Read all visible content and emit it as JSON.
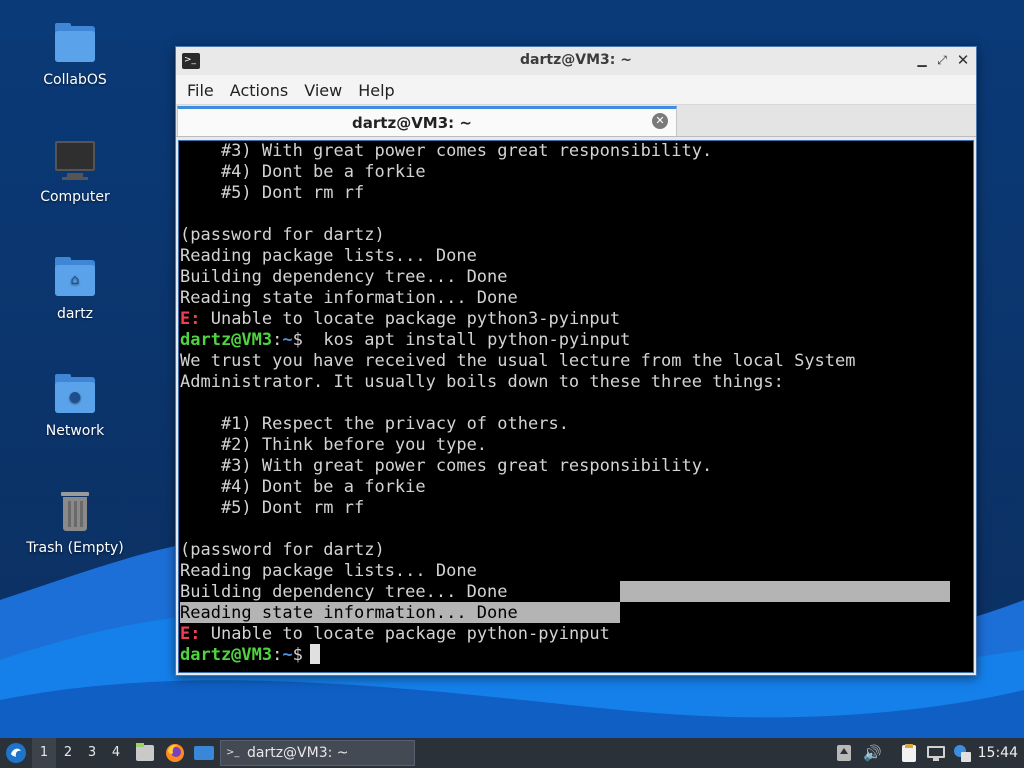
{
  "desktop": {
    "icons": [
      {
        "label": "CollabOS",
        "icon": "folder-icon"
      },
      {
        "label": "Computer",
        "icon": "monitor-icon"
      },
      {
        "label": "dartz",
        "icon": "home-folder-icon"
      },
      {
        "label": "Network",
        "icon": "network-folder-icon"
      },
      {
        "label": "Trash (Empty)",
        "icon": "trash-icon"
      }
    ]
  },
  "window": {
    "title": "dartz@VM3: ~",
    "menu": [
      "File",
      "Actions",
      "View",
      "Help"
    ],
    "tab_label": "dartz@VM3: ~",
    "controls": {
      "minimize": "minimize-icon",
      "maximize": "maximize-icon",
      "close": "close-icon"
    }
  },
  "terminal": {
    "prompt_user": "dartz@VM3",
    "prompt_sep": ":",
    "prompt_path": "~",
    "prompt_symbol": "$ ",
    "error_prefix": "E:",
    "lines": [
      "    #3) With great power comes great responsibility.",
      "    #4) Dont be a forkie",
      "    #5) Dont rm rf",
      "",
      "(password for dartz)",
      "Reading package lists... Done",
      "Building dependency tree... Done",
      "Reading state information... Done",
      " Unable to locate package python3-pyinput",
      " kos apt install python-pyinput",
      "We trust you have received the usual lecture from the local System",
      "Administrator. It usually boils down to these three things:",
      "",
      "    #1) Respect the privacy of others.",
      "    #2) Think before you type.",
      "    #3) With great power comes great responsibility.",
      "    #4) Dont be a forkie",
      "    #5) Dont rm rf",
      "",
      "(password for dartz)",
      "Reading package lists... Done",
      "Building dependency tree... Done",
      "Reading state information... Done",
      " Unable to locate package python-pyinput",
      ""
    ]
  },
  "taskbar": {
    "workspaces": [
      "1",
      "2",
      "3",
      "4"
    ],
    "active_workspace": "1",
    "task_label": "dartz@VM3: ~",
    "clock": "15:44",
    "launchers": [
      "start-menu-icon",
      "file-manager-icon",
      "firefox-icon",
      "show-desktop-icon"
    ],
    "tray": [
      "update-icon",
      "volume-icon",
      "clipboard-icon",
      "network-icon",
      "notification-icon"
    ]
  },
  "colors": {
    "prompt_user": "#4fd33f",
    "prompt_path": "#4f8fe0",
    "error": "#ef3e56",
    "terminal_bg": "#000000",
    "terminal_fg": "#d3d3d3",
    "accent": "#3d8ee0"
  }
}
